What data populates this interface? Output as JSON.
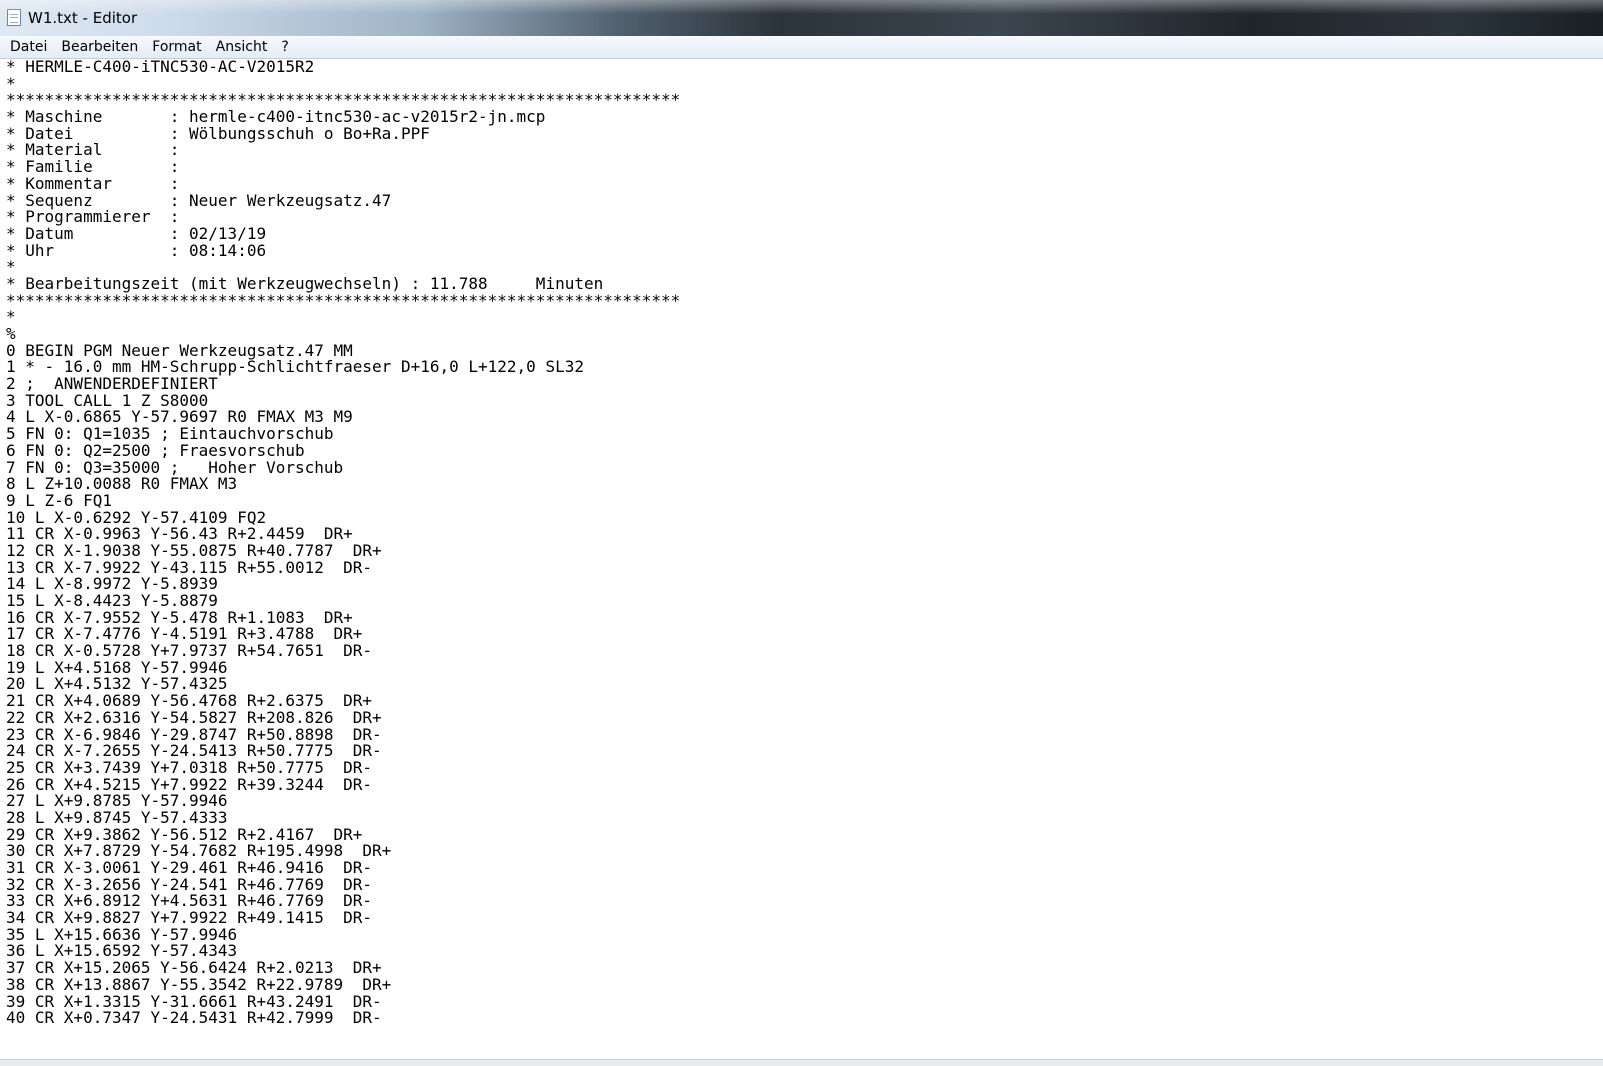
{
  "window": {
    "title": "W1.txt - Editor"
  },
  "menu": {
    "items": [
      "Datei",
      "Bearbeiten",
      "Format",
      "Ansicht",
      "?"
    ]
  },
  "editor": {
    "lines": [
      "* HERMLE-C400-iTNC530-AC-V2015R2",
      "*",
      "**********************************************************************",
      "* Maschine       : hermle-c400-itnc530-ac-v2015r2-jn.mcp",
      "* Datei          : Wölbungsschuh o Bo+Ra.PPF",
      "* Material       :",
      "* Familie        :",
      "* Kommentar      :",
      "* Sequenz        : Neuer Werkzeugsatz.47",
      "* Programmierer  :",
      "* Datum          : 02/13/19",
      "* Uhr            : 08:14:06",
      "*",
      "* Bearbeitungszeit (mit Werkzeugwechseln) : 11.788     Minuten",
      "**********************************************************************",
      "*",
      "%",
      "0 BEGIN PGM Neuer Werkzeugsatz.47 MM",
      "1 * - 16.0 mm HM-Schrupp-Schlichtfraeser D+16,0 L+122,0 SL32",
      "2 ;  ANWENDERDEFINIERT",
      "3 TOOL CALL 1 Z S8000",
      "4 L X-0.6865 Y-57.9697 R0 FMAX M3 M9",
      "5 FN 0: Q1=1035 ; Eintauchvorschub",
      "6 FN 0: Q2=2500 ; Fraesvorschub",
      "7 FN 0: Q3=35000 ;   Hoher Vorschub",
      "8 L Z+10.0088 R0 FMAX M3",
      "9 L Z-6 FQ1",
      "10 L X-0.6292 Y-57.4109 FQ2",
      "11 CR X-0.9963 Y-56.43 R+2.4459  DR+",
      "12 CR X-1.9038 Y-55.0875 R+40.7787  DR+",
      "13 CR X-7.9922 Y-43.115 R+55.0012  DR-",
      "14 L X-8.9972 Y-5.8939",
      "15 L X-8.4423 Y-5.8879",
      "16 CR X-7.9552 Y-5.478 R+1.1083  DR+",
      "17 CR X-7.4776 Y-4.5191 R+3.4788  DR+",
      "18 CR X-0.5728 Y+7.9737 R+54.7651  DR-",
      "19 L X+4.5168 Y-57.9946",
      "20 L X+4.5132 Y-57.4325",
      "21 CR X+4.0689 Y-56.4768 R+2.6375  DR+",
      "22 CR X+2.6316 Y-54.5827 R+208.826  DR+",
      "23 CR X-6.9846 Y-29.8747 R+50.8898  DR-",
      "24 CR X-7.2655 Y-24.5413 R+50.7775  DR-",
      "25 CR X+3.7439 Y+7.0318 R+50.7775  DR-",
      "26 CR X+4.5215 Y+7.9922 R+39.3244  DR-",
      "27 L X+9.8785 Y-57.9946",
      "28 L X+9.8745 Y-57.4333",
      "29 CR X+9.3862 Y-56.512 R+2.4167  DR+",
      "30 CR X+7.8729 Y-54.7682 R+195.4998  DR+",
      "31 CR X-3.0061 Y-29.461 R+46.9416  DR-",
      "32 CR X-3.2656 Y-24.541 R+46.7769  DR-",
      "33 CR X+6.8912 Y+4.5631 R+46.7769  DR-",
      "34 CR X+9.8827 Y+7.9922 R+49.1415  DR-",
      "35 L X+15.6636 Y-57.9946",
      "36 L X+15.6592 Y-57.4343",
      "37 CR X+15.2065 Y-56.6424 R+2.0213  DR+",
      "38 CR X+13.8867 Y-55.3542 R+22.9789  DR+",
      "39 CR X+1.3315 Y-31.6661 R+43.2491  DR-",
      "40 CR X+0.7347 Y-24.5431 R+42.7999  DR-"
    ]
  }
}
